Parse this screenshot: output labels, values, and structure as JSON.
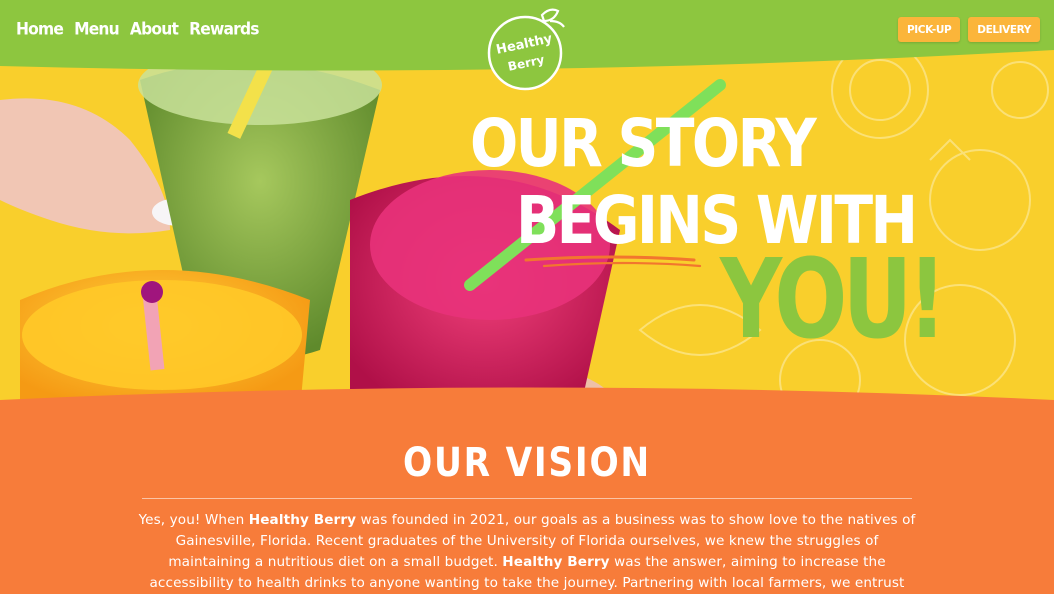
{
  "nav": {
    "links": [
      "Home",
      "Menu",
      "About",
      "Rewards"
    ],
    "pickup_label": "PICK-UP",
    "delivery_label": "DELIVERY"
  },
  "logo": {
    "line1": "Healthy",
    "line2": "Berry"
  },
  "hero": {
    "line1": "OUR STORY",
    "line2": "BEGINS WITH",
    "line3": "YOU!"
  },
  "vision": {
    "title": "OUR VISION",
    "p1": "Yes, you! When ",
    "brand1": "Healthy Berry",
    "p2": " was founded in 2021, our goals as a business was to show love to the natives of Gainesville, Florida. Recent graduates of the University of Florida ourselves, we knew the struggles of maintaining a nutritious diet on a small budget. ",
    "brand2": "Healthy Berry",
    "p3": " was the answer, aiming to increase the accessibility to health drinks to anyone wanting to take the journey. Partnering with local farmers, we entrust"
  },
  "colors": {
    "nav_green": "#8dc63f",
    "hero_yellow": "#f9cf2c",
    "accent_orange": "#f77c3a",
    "button_orange": "#fbb53a",
    "you_green": "#8cc63f"
  }
}
